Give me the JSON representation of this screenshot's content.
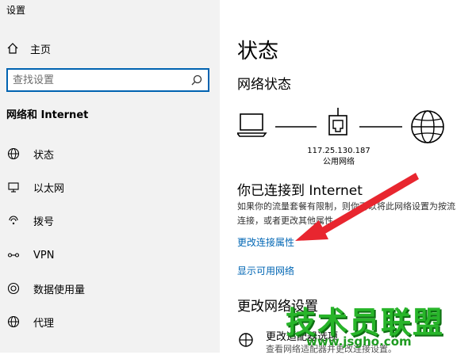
{
  "window": {
    "title": "设置"
  },
  "sidebar": {
    "home_label": "主页",
    "search_placeholder": "查找设置",
    "section_title": "网络和 Internet",
    "items": [
      {
        "label": "状态",
        "icon": "globe-icon"
      },
      {
        "label": "以太网",
        "icon": "monitor-icon"
      },
      {
        "label": "拨号",
        "icon": "phone-icon"
      },
      {
        "label": "VPN",
        "icon": "vpn-icon"
      },
      {
        "label": "数据使用量",
        "icon": "data-usage-icon"
      },
      {
        "label": "代理",
        "icon": "globe-icon"
      }
    ]
  },
  "main": {
    "title": "状态",
    "network_status_title": "网络状态",
    "ip_address": "117.25.130.187",
    "network_type": "公用网络",
    "connected_title": "你已连接到 Internet",
    "description_line1": "如果你的流量套餐有限制，则你可以将此网络设置为按流",
    "description_line2": "连接，或者更改其他属性。",
    "link_change_properties": "更改连接属性",
    "link_show_networks": "显示可用网络",
    "change_network_title": "更改网络设置",
    "option_label": "更改适配器选项",
    "option_desc": "查看网络适配器并更改连接设置。"
  },
  "watermark": {
    "text": "技术员联盟",
    "url": "www.jsgho.com"
  },
  "colors": {
    "link": "#0066b4",
    "accent": "#0063b1",
    "arrow": "#e8262f",
    "watermark": "#28b52a"
  }
}
